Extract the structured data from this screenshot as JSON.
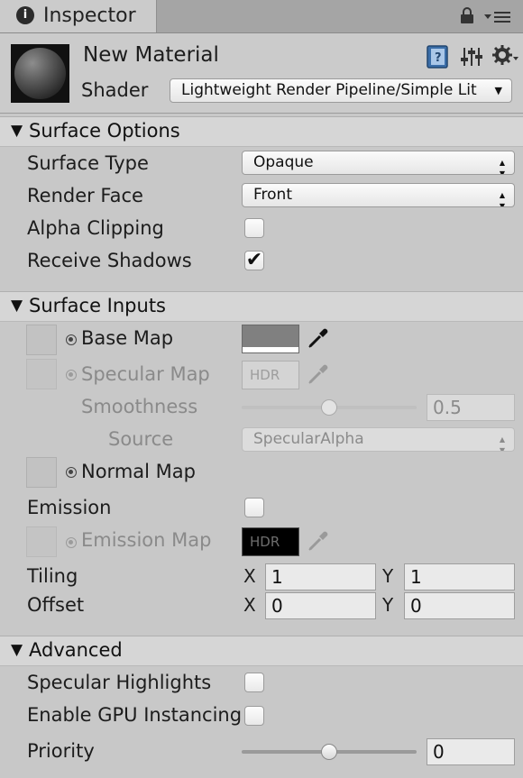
{
  "tab": {
    "title": "Inspector",
    "icon": "info-icon",
    "lock_icon": "lock-icon",
    "menu_icon": "menu-icon"
  },
  "header": {
    "material_name": "New Material",
    "shader_label": "Shader",
    "shader_value": "Lightweight Render Pipeline/Simple Lit",
    "icons": [
      "help-book-icon",
      "preset-sliders-icon",
      "settings-gear-icon"
    ]
  },
  "surface_options": {
    "title": "Surface Options",
    "surface_type": {
      "label": "Surface Type",
      "value": "Opaque"
    },
    "render_face": {
      "label": "Render Face",
      "value": "Front"
    },
    "alpha_clipping": {
      "label": "Alpha Clipping",
      "checked": false
    },
    "receive_shadows": {
      "label": "Receive Shadows",
      "checked": true,
      "mark": "✔"
    }
  },
  "surface_inputs": {
    "title": "Surface Inputs",
    "base_map": {
      "label": "Base Map",
      "color": "#808080"
    },
    "specular_map": {
      "label": "Specular Map",
      "swatch_text": "HDR"
    },
    "smoothness": {
      "label": "Smoothness",
      "value": "0.5",
      "fraction": 0.5
    },
    "source": {
      "label": "Source",
      "value": "SpecularAlpha"
    },
    "normal_map": {
      "label": "Normal Map"
    },
    "emission": {
      "label": "Emission",
      "checked": false
    },
    "emission_map": {
      "label": "Emission Map",
      "swatch_text": "HDR",
      "color": "#000000"
    },
    "tiling": {
      "label": "Tiling",
      "x_label": "X",
      "x": "1",
      "y_label": "Y",
      "y": "1"
    },
    "offset": {
      "label": "Offset",
      "x_label": "X",
      "x": "0",
      "y_label": "Y",
      "y": "0"
    }
  },
  "advanced": {
    "title": "Advanced",
    "specular_highlights": {
      "label": "Specular Highlights",
      "checked": false
    },
    "gpu_instancing": {
      "label": "Enable GPU Instancing",
      "checked": false
    },
    "priority": {
      "label": "Priority",
      "value": "0",
      "fraction": 0.5
    }
  },
  "dropdown_arrows": "▲▼",
  "section_arrow": "▼"
}
